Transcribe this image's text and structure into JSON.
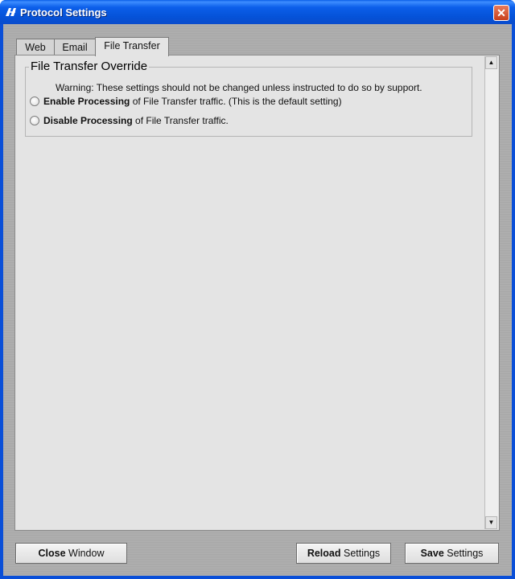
{
  "window": {
    "title": "Protocol Settings",
    "app_icon": "app-logo-icon",
    "close_symbol": "✕"
  },
  "tabs": [
    {
      "label": "Web",
      "active": false
    },
    {
      "label": "Email",
      "active": false
    },
    {
      "label": "File Transfer",
      "active": true
    }
  ],
  "group": {
    "title": "File Transfer Override",
    "warning": "Warning:  These settings should not be changed unless instructed to do so by support.",
    "options": [
      {
        "bold": "Enable Processing",
        "rest": " of File Transfer traffic. (This is the default setting)",
        "selected": false
      },
      {
        "bold": "Disable Processing",
        "rest": " of File Transfer traffic.",
        "selected": false
      }
    ]
  },
  "scrollbar": {
    "up_symbol": "▲",
    "down_symbol": "▼"
  },
  "buttons": {
    "close": {
      "bold": "Close",
      "rest": " Window"
    },
    "reload": {
      "bold": "Reload",
      "rest": " Settings"
    },
    "save": {
      "bold": "Save",
      "rest": " Settings"
    }
  },
  "colors": {
    "titlebar": "#0552d8",
    "panel": "#e4e4e4",
    "close_button": "#c9401c"
  }
}
